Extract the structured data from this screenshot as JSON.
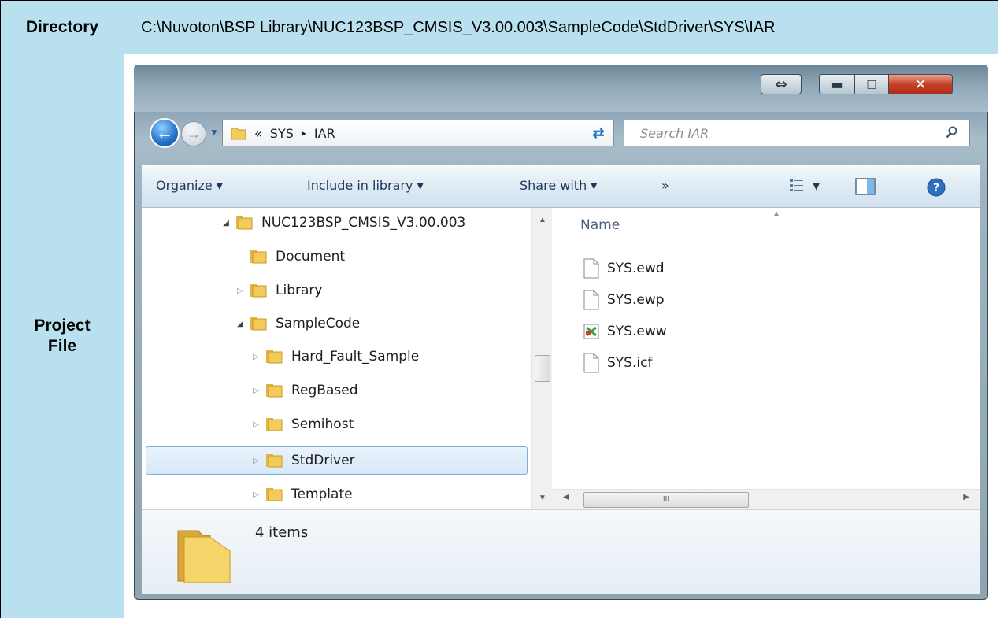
{
  "table": {
    "directory_label": "Directory",
    "directory_value": "C:\\Nuvoton\\BSP Library\\NUC123BSP_CMSIS_V3.00.003\\SampleCode\\StdDriver\\SYS\\IAR",
    "project_label": "Project File"
  },
  "window": {
    "address": {
      "overflow": "«",
      "crumbs": [
        "SYS",
        "▸",
        "IAR"
      ]
    },
    "search_placeholder": "Search IAR",
    "toolbar": {
      "organize": "Organize ▾",
      "include_in_library": "Include in library ▾",
      "share_with": "Share with ▾",
      "more": "»"
    },
    "tree": [
      {
        "label": "NUC123BSP_CMSIS_V3.00.003",
        "arrow": "◢"
      },
      {
        "label": "Document",
        "arrow": ""
      },
      {
        "label": "Library",
        "arrow": "▷"
      },
      {
        "label": "SampleCode",
        "arrow": "◢"
      },
      {
        "label": "Hard_Fault_Sample",
        "arrow": "▷"
      },
      {
        "label": "RegBased",
        "arrow": "▷"
      },
      {
        "label": "Semihost",
        "arrow": "▷"
      },
      {
        "label": "StdDriver",
        "arrow": "▷"
      },
      {
        "label": "Template",
        "arrow": "▷"
      }
    ],
    "file_column": "Name",
    "files": [
      {
        "name": "SYS.ewd",
        "icon": "document-icon"
      },
      {
        "name": "SYS.ewp",
        "icon": "document-icon"
      },
      {
        "name": "SYS.eww",
        "icon": "workspace-icon"
      },
      {
        "name": "SYS.icf",
        "icon": "document-icon"
      }
    ],
    "hscroll_grip": "III",
    "status": "4 items"
  },
  "colors": {
    "header_bg": "#b8e0ee",
    "folder": "#f2cb5a",
    "selection": "#d6e8f8"
  }
}
